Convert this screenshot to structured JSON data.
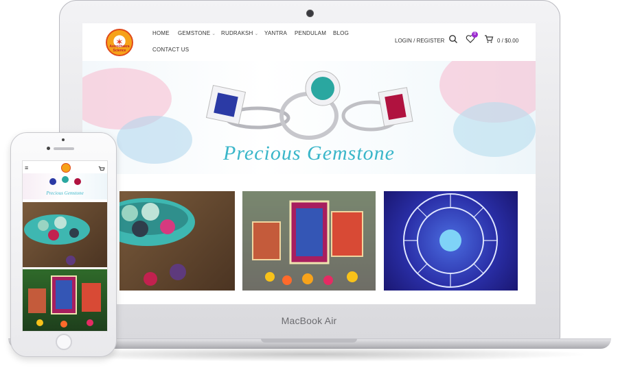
{
  "site": {
    "logo_text": "Astrochakra Science",
    "nav": [
      {
        "label": "HOME",
        "has_dropdown": false
      },
      {
        "label": "GEMSTONE",
        "has_dropdown": true
      },
      {
        "label": "RUDRAKSH",
        "has_dropdown": true
      },
      {
        "label": "YANTRA",
        "has_dropdown": false
      },
      {
        "label": "PENDULAM",
        "has_dropdown": false
      },
      {
        "label": "BLOG",
        "has_dropdown": false
      },
      {
        "label": "CONTACT US",
        "has_dropdown": false
      }
    ],
    "login_label": "LOGIN / REGISTER",
    "wishlist_count": "0",
    "cart_label": "0 / $0.00",
    "hero_title": "Precious Gemstone",
    "tiles": [
      {
        "name": "gemstones-bowl-image"
      },
      {
        "name": "deity-altar-image"
      },
      {
        "name": "zodiac-wheel-image"
      }
    ]
  },
  "device": {
    "laptop_label": "MacBook Air"
  },
  "phone": {
    "hero_title": "Precious Gemstone"
  },
  "colors": {
    "accent": "#9b2ad0",
    "hero_text": "#3ab6c9",
    "logo_orange": "#f6a21a"
  },
  "icons": {
    "search": "search-icon",
    "wishlist": "heart-icon",
    "cart": "cart-icon",
    "menu": "hamburger-icon"
  }
}
